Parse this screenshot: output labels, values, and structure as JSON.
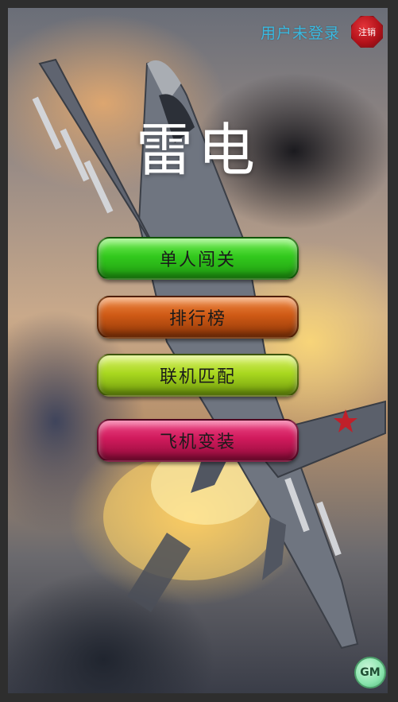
{
  "header": {
    "login_status": "用户未登录",
    "logout_label": "注销"
  },
  "title": "雷电",
  "menu": {
    "single_player": "单人闯关",
    "leaderboard": "排行榜",
    "online_match": "联机匹配",
    "plane_outfit": "飞机变装"
  },
  "gm_label": "GM",
  "colors": {
    "single_player": "#32c91d",
    "leaderboard": "#cf5a15",
    "online_match": "#a9d81f",
    "plane_outfit": "#d01a5c",
    "login_status": "#39b9e0",
    "logout": "#b3121a"
  },
  "icons": {
    "background": "fighter-jet-illustration",
    "logout": "red-octagon-badge"
  }
}
